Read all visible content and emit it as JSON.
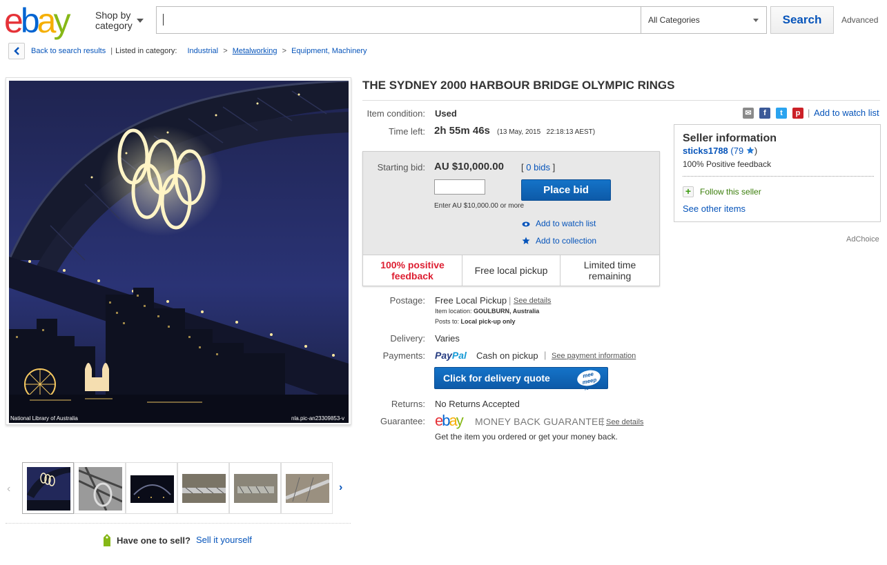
{
  "header": {
    "logo_letters": [
      "e",
      "b",
      "a",
      "y"
    ],
    "logo_colors": [
      "#e53238",
      "#0064d2",
      "#f5af02",
      "#86b817"
    ],
    "shop_by_line1": "Shop by",
    "shop_by_line2": "category",
    "search_value": "",
    "category_selected": "All Categories",
    "search_label": "Search",
    "advanced_label": "Advanced"
  },
  "breadcrumb": {
    "back_label": "Back to search results",
    "listed_label": "Listed in category:",
    "items": [
      "Industrial",
      "Metalworking",
      "Equipment, Machinery"
    ]
  },
  "image": {
    "caption_left": "National Library of Australia",
    "caption_right": "nla.pic-an23309853-v",
    "thumbnail_count": 6
  },
  "sell": {
    "prompt": "Have one to sell?",
    "link": "Sell it yourself"
  },
  "item": {
    "title": "THE SYDNEY 2000 HARBOUR BRIDGE OLYMPIC RINGS",
    "condition_label": "Item condition:",
    "condition_value": "Used",
    "time_left_label": "Time left:",
    "time_left_value": "2h 55m 46s",
    "time_left_end": "(13 May, 2015   22:18:13 AEST)",
    "watch_list_link": "Add to watch list"
  },
  "bid": {
    "starting_label": "Starting bid:",
    "starting_value": "AU $10,000.00",
    "bids_open": "[",
    "bids_link": "0 bids",
    "bids_close": "]",
    "input_value": "",
    "place_bid_label": "Place bid",
    "hint": "Enter AU $10,000.00 or more",
    "watch_link": "Add to watch list",
    "collection_link": "Add to collection",
    "features": [
      "100% positive feedback",
      "Free local pickup",
      "Limited time remaining"
    ]
  },
  "shipping": {
    "postage_label": "Postage:",
    "postage_value": "Free Local Pickup",
    "see_details": "See details",
    "location_label": "Item location:",
    "location_value": "GOULBURN, Australia",
    "posts_label": "Posts to:",
    "posts_value": "Local pick-up only",
    "delivery_label": "Delivery:",
    "delivery_value": "Varies",
    "payments_label": "Payments:",
    "paypal_pay": "Pay",
    "paypal_pal": "Pal",
    "payments_value": "Cash on pickup",
    "payment_info_link": "See payment information",
    "delivery_quote_label": "Click for delivery quote",
    "meemeep_label": "mee meep .com",
    "returns_label": "Returns:",
    "returns_value": "No Returns Accepted",
    "guarantee_label": "Guarantee:",
    "guarantee_title": "MONEY BACK GUARANTEE",
    "guarantee_details": "See details",
    "guarantee_text": "Get the item you ordered or get your money back."
  },
  "seller": {
    "title": "Seller information",
    "name": "sticks1788",
    "score": "(79",
    "score_close": ")",
    "feedback": "100% Positive feedback",
    "follow": "Follow this seller",
    "other_items": "See other items"
  },
  "adchoice": "AdChoice"
}
